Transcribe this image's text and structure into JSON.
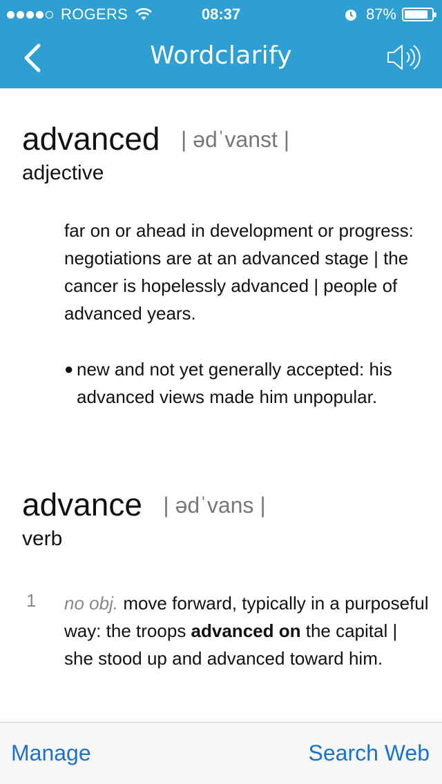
{
  "status_bar": {
    "carrier": "ROGERS",
    "time": "08:37",
    "battery_percent": "87%",
    "battery_level": 0.87
  },
  "nav": {
    "title": "Wordclarify",
    "back_icon": "chevron-left-icon",
    "speaker_icon": "speaker-icon"
  },
  "entries": [
    {
      "headword": "advanced",
      "pronunciation": "| ədˈvanst |",
      "part_of_speech": "adjective",
      "definition": "far on or ahead in development or progress: negotiations are at an advanced stage | the cancer is hopelessly advanced | people of advanced years.",
      "sub_definition": "new and not yet generally accepted: his advanced views made him unpopular."
    },
    {
      "headword": "advance",
      "pronunciation": "| ədˈvans |",
      "part_of_speech": "verb",
      "senses": [
        {
          "number": "1",
          "label": "no obj.",
          "text_before": "move forward, typically in a purposeful way: the troops",
          "bold": "advanced on",
          "text_after": "the capital | she stood up and advanced toward him."
        }
      ]
    }
  ],
  "bottom_bar": {
    "manage_label": "Manage",
    "search_web_label": "Search Web"
  },
  "colors": {
    "nav_bg": "#2e9fd3",
    "link_blue": "#1a72c9"
  }
}
